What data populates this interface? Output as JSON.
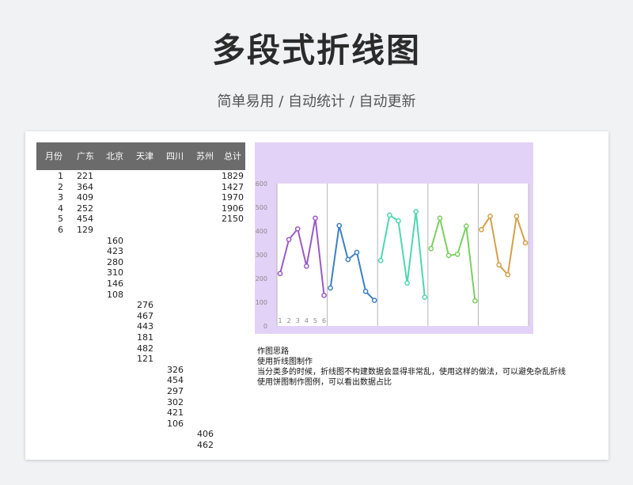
{
  "header": {
    "title": "多段式折线图",
    "subtitle": "简单易用 / 自动统计 / 自动更新"
  },
  "table": {
    "columns": [
      "月份",
      "广东",
      "北京",
      "天津",
      "四川",
      "苏州",
      "总计"
    ],
    "months": [
      "1",
      "2",
      "3",
      "4",
      "5",
      "6"
    ],
    "totals": [
      "1829",
      "1427",
      "1970",
      "1906",
      "2150"
    ],
    "blocks": [
      {
        "name": "广东",
        "values": [
          "221",
          "364",
          "409",
          "252",
          "454",
          "129"
        ]
      },
      {
        "name": "北京",
        "values": [
          "160",
          "423",
          "280",
          "310",
          "146",
          "108"
        ]
      },
      {
        "name": "天津",
        "values": [
          "276",
          "467",
          "443",
          "181",
          "482",
          "121"
        ]
      },
      {
        "name": "四川",
        "values": [
          "326",
          "454",
          "297",
          "302",
          "421",
          "106"
        ]
      },
      {
        "name": "苏州",
        "values": [
          "406",
          "462"
        ]
      }
    ]
  },
  "chart_data": {
    "type": "line",
    "title": "",
    "xlabel": "",
    "ylabel": "",
    "ylim": [
      0,
      600
    ],
    "yticks": [
      "0",
      "100",
      "200",
      "300",
      "400",
      "500",
      "600"
    ],
    "x": [
      "1",
      "2",
      "3",
      "4",
      "5",
      "6"
    ],
    "grid": false,
    "background_color": "#e3d2f7",
    "series": [
      {
        "values": [
          221,
          364,
          409,
          252,
          454,
          129
        ],
        "color": "#9b59c6"
      },
      {
        "values": [
          160,
          423,
          280,
          310,
          146,
          108
        ],
        "color": "#3d7fc4"
      },
      {
        "values": [
          276,
          467,
          443,
          181,
          482,
          121
        ],
        "color": "#4fd6b0"
      },
      {
        "values": [
          326,
          454,
          297,
          302,
          421,
          106
        ],
        "color": "#7ccf60"
      },
      {
        "values": [
          406,
          462,
          257,
          216,
          462,
          350
        ],
        "color": "#d4a04a"
      }
    ]
  },
  "notes": {
    "heading": "作图思路",
    "line1": "使用折线图制作",
    "line2": "当分类多的时候，折线图不构建数据会显得非常乱，使用这样的做法，可以避免杂乱折线",
    "line3": "使用饼图制作图例，可以看出数据占比"
  }
}
